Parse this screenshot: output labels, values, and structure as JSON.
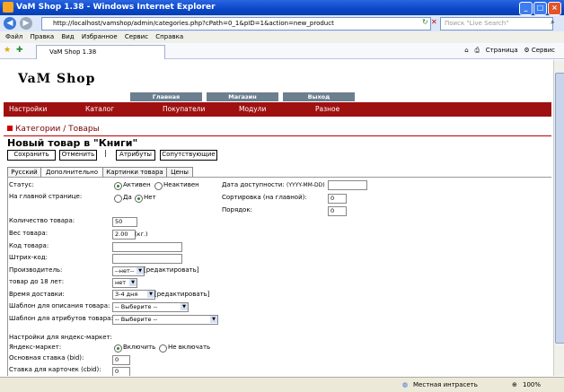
{
  "window": {
    "title": "VaM Shop 1.38 - Windows Internet Explorer"
  },
  "address": {
    "url": "http://localhost/vamshop/admin/categories.php?cPath=0_1&pID=1&action=new_product",
    "search_placeholder": "Поиск \"Live Search\""
  },
  "menu": [
    "Файл",
    "Правка",
    "Вид",
    "Избранное",
    "Сервис",
    "Справка"
  ],
  "browser_tab": {
    "label": "VaM Shop 1.38"
  },
  "toolbar": {
    "page_label": "Страница",
    "tools_label": "Сервис"
  },
  "site": {
    "logo": "VaM Shop",
    "top_tabs": [
      "Главная",
      "Магазин",
      "Выход"
    ],
    "nav": [
      "Настройки",
      "Каталог",
      "Покупатели",
      "Модули",
      "Разное"
    ],
    "breadcrumb": "Категории / Товары",
    "heading": "Новый товар в \"Книги\"",
    "buttons": {
      "save": "Сохранить",
      "cancel": "Отменить",
      "attributes": "Атрибуты",
      "related": "Сопутствующие"
    },
    "form_tabs": [
      "Русский",
      "Дополнительно",
      "Картинки товара",
      "Цены"
    ]
  },
  "form": {
    "status_label": "Статус:",
    "status_active": "Активен",
    "status_inactive": "Неактивен",
    "home_label": "На главной странице:",
    "home_yes": "Да",
    "home_no": "Нет",
    "avail_label": "Дата доступности:",
    "avail_hint": "(YYYY-MM-DD)",
    "sort_home_label": "Сортировка (на главной):",
    "sort_home_value": "0",
    "order_label": "Порядок:",
    "order_value": "0",
    "qty_label": "Количество товара:",
    "qty_value": "50",
    "weight_label": "Вес товара:",
    "weight_value": "2.00",
    "weight_unit": "(кг.)",
    "code_label": "Код товара:",
    "barcode_label": "Штрих-код:",
    "manufacturer_label": "Производитель:",
    "manufacturer_value": "--нет--",
    "edit_link": "[редактировать]",
    "adult_label": "товар до 18 лет:",
    "adult_value": "нет",
    "delivery_label": "Время доставки:",
    "delivery_value": "3-4 дня",
    "desc_tpl_label": "Шаблон для описания товара:",
    "attr_tpl_label": "Шаблон для атрибутов товара:",
    "choose": "-- Выберите --",
    "yandex_settings": "Настройки для яндекс-маркет:",
    "yandex_label": "Яндекс-маркет:",
    "yandex_on": "Включить",
    "yandex_off": "Не включать",
    "bid_label": "Основная ставка (bid):",
    "bid_value": "0",
    "cbid_label": "Ставка для карточек (cbid):",
    "cbid_value": "0"
  },
  "status": {
    "zone": "Местная интрасеть",
    "zoom": "100%"
  }
}
